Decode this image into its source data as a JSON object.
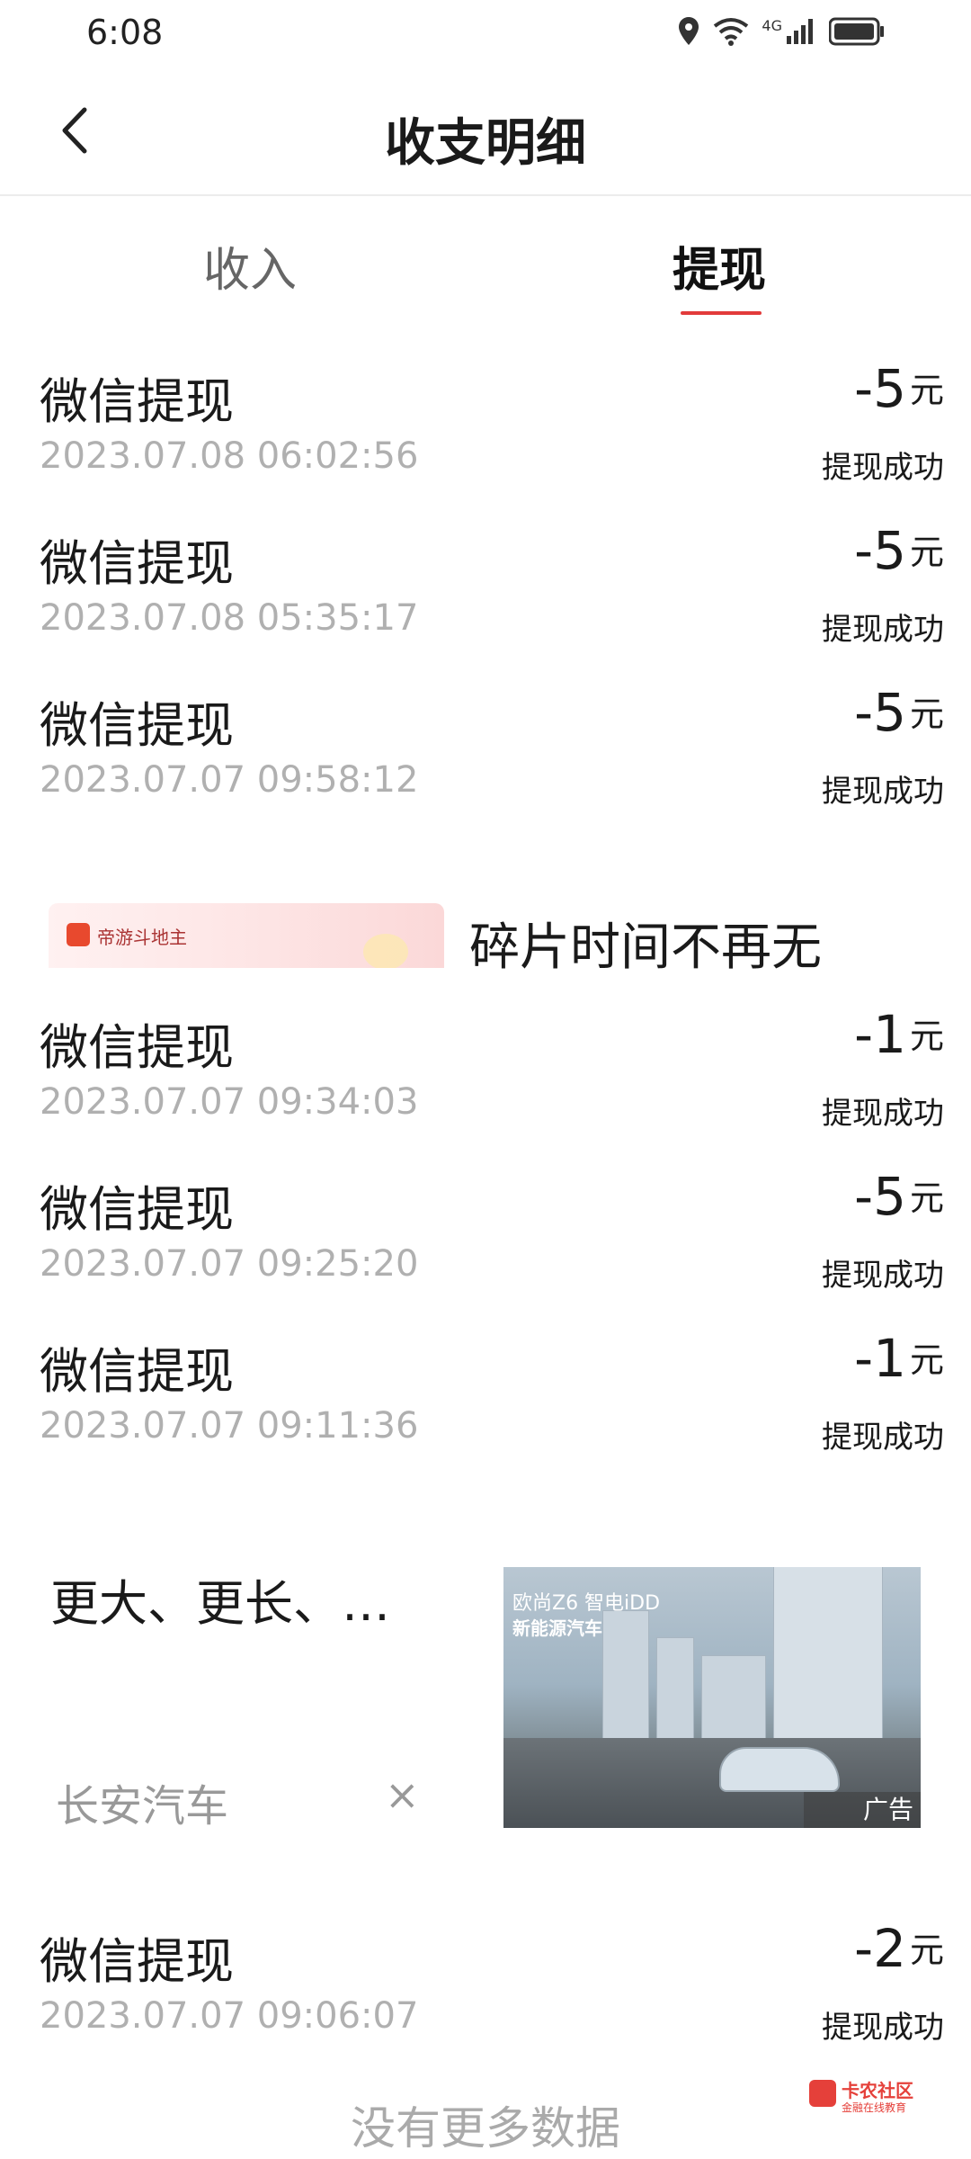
{
  "status_bar": {
    "time": "6:08",
    "network": "4G"
  },
  "header": {
    "title": "收支明细"
  },
  "tabs": [
    {
      "label": "收入",
      "active": false
    },
    {
      "label": "提现",
      "active": true
    }
  ],
  "records": [
    {
      "title": "微信提现",
      "time": "2023.07.08 06:02:56",
      "amount": "-5",
      "unit": "元",
      "status": "提现成功"
    },
    {
      "title": "微信提现",
      "time": "2023.07.08 05:35:17",
      "amount": "-5",
      "unit": "元",
      "status": "提现成功"
    },
    {
      "title": "微信提现",
      "time": "2023.07.07 09:58:12",
      "amount": "-5",
      "unit": "元",
      "status": "提现成功"
    },
    {
      "title": "微信提现",
      "time": "2023.07.07 09:34:03",
      "amount": "-1",
      "unit": "元",
      "status": "提现成功"
    },
    {
      "title": "微信提现",
      "time": "2023.07.07 09:25:20",
      "amount": "-5",
      "unit": "元",
      "status": "提现成功"
    },
    {
      "title": "微信提现",
      "time": "2023.07.07 09:11:36",
      "amount": "-1",
      "unit": "元",
      "status": "提现成功"
    },
    {
      "title": "微信提现",
      "time": "2023.07.07 09:06:07",
      "amount": "-2",
      "unit": "元",
      "status": "提现成功"
    }
  ],
  "ad_banner": {
    "app_name": "帝游斗地主",
    "text": "碎片时间不再无"
  },
  "ad_car": {
    "title": "更大、更长、…",
    "brand": "长安汽车",
    "close": "×",
    "image_title": "欧尚Z6 智电iDD",
    "image_subtitle": "新能源汽车",
    "label": "广告"
  },
  "footer": {
    "text": "没有更多数据"
  },
  "watermark": {
    "title": "卡农社区",
    "subtitle": "金融在线教育"
  }
}
